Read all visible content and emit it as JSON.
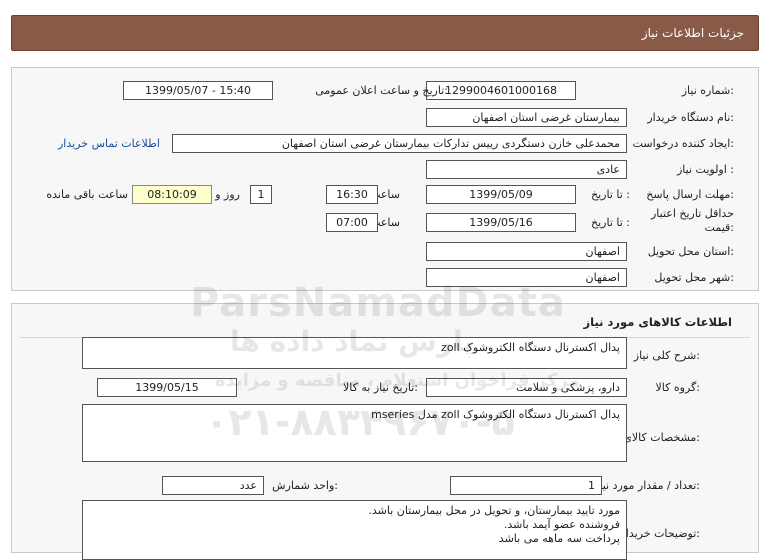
{
  "header": {
    "title": "جزئیات اطلاعات نیاز"
  },
  "section1": {
    "need_number_label": "شماره نیاز:",
    "need_number": "1299004601000168",
    "announce_label": "تاریخ و ساعت اعلان عمومی:",
    "announce_value": "1399/05/07 - 15:40",
    "buyer_label": "نام دستگاه خریدار:",
    "buyer_value": "بیمارستان غرضی استان اصفهان",
    "creator_label": "ایجاد کننده درخواست:",
    "creator_value": "محمدعلی خازن دستگردی رییس تدارکات بیمارستان غرضی استان اصفهان",
    "contact_link": "اطلاعات تماس خریدار",
    "priority_label": "اولویت نیاز :",
    "priority_value": "عادی",
    "deadline_label": "مهلت ارسال پاسخ:",
    "to_date_label": "تا تاریخ :",
    "deadline_date": "1399/05/09",
    "time_label": "ساعت",
    "deadline_time": "16:30",
    "days_value": "1",
    "days_label": "روز و",
    "remaining_value": "08:10:09",
    "remaining_label": "ساعت باقی مانده",
    "validity_label_1": "حداقل تاریخ اعتبار",
    "validity_label_2": "قیمت:",
    "validity_to_label": "تا تاریخ :",
    "validity_date": "1399/05/16",
    "validity_time_label": "ساعت",
    "validity_time": "07:00",
    "province_label": "استان محل تحویل:",
    "province_value": "اصفهان",
    "city_label": "شهر محل تحویل:",
    "city_value": "اصفهان"
  },
  "section2": {
    "title": "اطلاعات کالاهای مورد نیاز",
    "summary_label": "شرح کلی نیاز:",
    "summary_value": "پدال اکسترنال دستگاه الکتروشوک zoll",
    "group_label": "گروه کالا:",
    "group_value": "دارو، پزشکی و سلامت",
    "need_date_label": "تاریخ نیاز به کالا:",
    "need_date_value": "1399/05/15",
    "specs_label": "مشخصات کالای مورد نیاز:",
    "specs_value": "پدال اکسترنال دستگاه الکتروشوک zoll مدل mseries",
    "qty_label": "تعداد / مقدار مورد نیاز:",
    "qty_value": "1",
    "unit_label": "واحد شمارش:",
    "unit_value": "عدد",
    "buyer_notes_label": "توضیحات خریدار:",
    "buyer_notes_lines": [
      "مورد تایید بیمارستان، و تحویل در محل بیمارستان باشد.",
      "فروشنده عضو آیمد باشد.",
      "پرداخت سه ماهه می باشد"
    ]
  },
  "watermark": {
    "brand": "ParsNamadData",
    "brand_fa": "پارس نماد داده ها",
    "tagline": "مرکز فراخوان استعلام ، مناقصه و مزایده",
    "phone": "۰۲۱-۸۸۳۴۹۶۷۰-۵"
  }
}
